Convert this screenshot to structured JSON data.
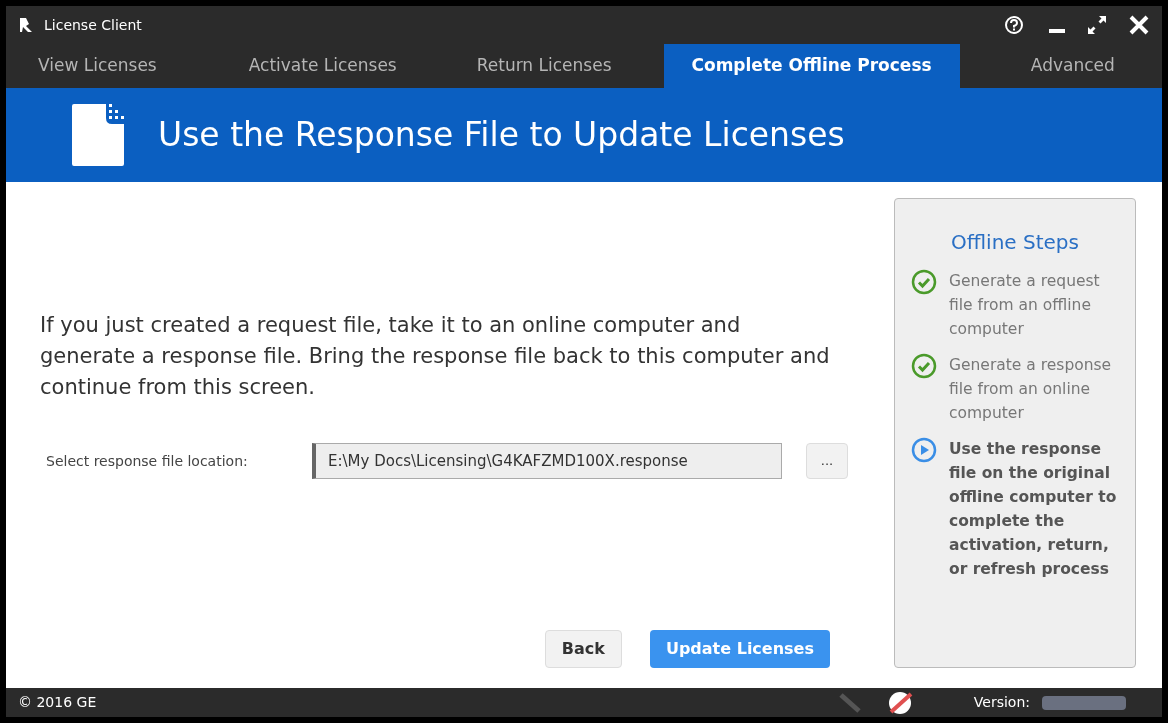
{
  "window": {
    "title": "License Client"
  },
  "tabs": [
    {
      "label": "View Licenses",
      "selected": false
    },
    {
      "label": "Activate Licenses",
      "selected": false
    },
    {
      "label": "Return Licenses",
      "selected": false
    },
    {
      "label": "Complete Offline Process",
      "selected": true
    },
    {
      "label": "Advanced",
      "selected": false
    }
  ],
  "header": {
    "title": "Use the Response File to Update Licenses"
  },
  "instructions": "If you just created a request file, take it to an online computer and generate a response file. Bring the response file back to this computer and continue from this screen.",
  "file_field": {
    "label": "Select response file location:",
    "value": "E:\\My Docs\\Licensing\\G4KAFZMD100X.response",
    "browse": "..."
  },
  "buttons": [
    {
      "label": "Back",
      "kind": "secondary"
    },
    {
      "label": "Update Licenses",
      "kind": "primary"
    }
  ],
  "steps_panel": {
    "title": "Offline Steps",
    "steps": [
      {
        "text": "Generate a request file from an offline computer",
        "kind": "done"
      },
      {
        "text": "Generate a response file from an online computer",
        "kind": "done"
      },
      {
        "text": "Use the response file on the original offline computer to complete the activation, return, or refresh process",
        "kind": "current"
      }
    ]
  },
  "status_bar": {
    "copyright": "© 2016 GE",
    "version_label": "Version:"
  }
}
